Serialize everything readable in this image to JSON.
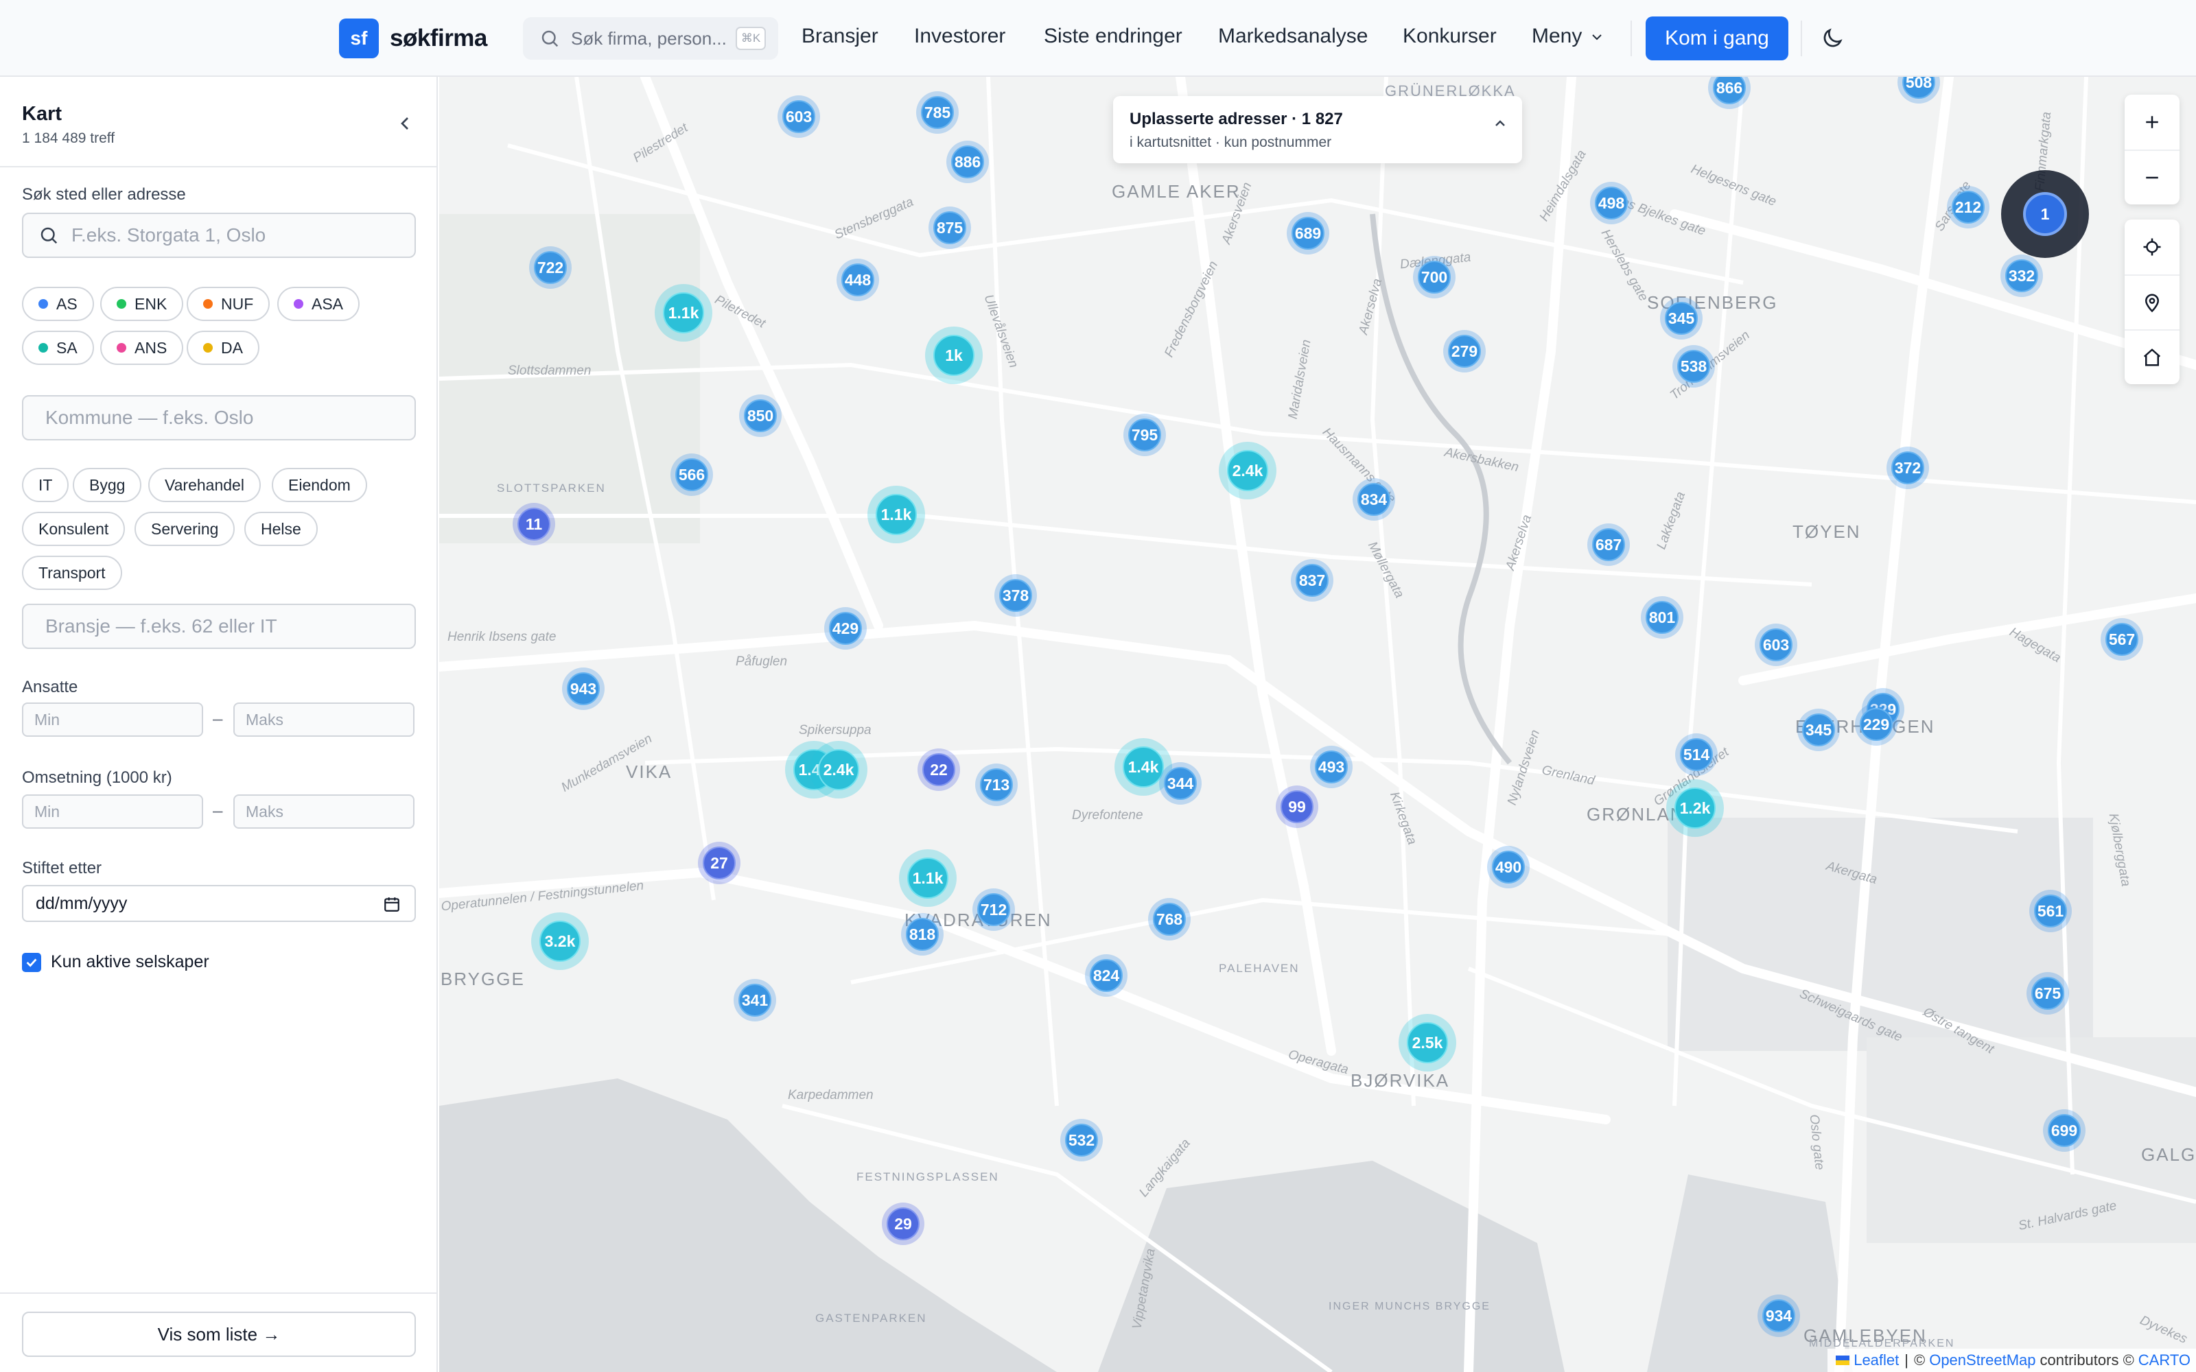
{
  "header": {
    "brand_logo": "sf",
    "brand_name": "søkfirma",
    "search_placeholder": "Søk firma, person...",
    "search_shortcut": "⌘K",
    "nav": [
      "Bransjer",
      "Investorer",
      "Siste endringer",
      "Markedsanalyse",
      "Konkurser"
    ],
    "menu_label": "Meny",
    "cta_label": "Kom i gang"
  },
  "sidebar": {
    "title": "Kart",
    "count": "1 184 489 treff",
    "place_label": "Søk sted eller adresse",
    "place_placeholder": "F.eks. Storgata 1, Oslo",
    "org_types": [
      {
        "label": "AS",
        "color": "#3b82f6"
      },
      {
        "label": "ENK",
        "color": "#22c55e"
      },
      {
        "label": "NUF",
        "color": "#f97316"
      },
      {
        "label": "ASA",
        "color": "#a855f7"
      },
      {
        "label": "SA",
        "color": "#14b8a6"
      },
      {
        "label": "ANS",
        "color": "#ec4899"
      },
      {
        "label": "DA",
        "color": "#eab308"
      }
    ],
    "kommune_placeholder": "Kommune — f.eks. Oslo",
    "industries": [
      "IT",
      "Bygg",
      "Varehandel",
      "Eiendom",
      "Konsulent",
      "Servering",
      "Helse",
      "Transport"
    ],
    "bransje_placeholder": "Bransje — f.eks. 62 eller IT",
    "employees_label": "Ansatte",
    "revenue_label": "Omsetning (1000 kr)",
    "min_placeholder": "Min",
    "max_placeholder": "Maks",
    "range_dash": "–",
    "founded_label": "Stiftet etter",
    "date_placeholder": "dd/mm/yyyy",
    "active_label": "Kun aktive selskaper",
    "active_checked": true,
    "list_button": "Vis som liste →"
  },
  "map": {
    "unplaced_title": "Uplasserte adresser · 1 827",
    "unplaced_sub": "i kartutsnittet · kun postnummer",
    "places": [
      "GRÜNERLØKKA",
      "GAMLE AKER",
      "SOFIENBERG",
      "TØYEN",
      "SLOTTSPARKEN",
      "VIKA",
      "ENERHAUGEN",
      "GRØNLAND",
      "KVADRATUREN",
      "BRYGGE",
      "BJØRVIKA",
      "GALGEBE",
      "GAMLEBYEN",
      "FESTNINGSPLASSEN",
      "GASTENPARKEN",
      "PALEHAVEN",
      "INGER MUNCHS BRYGGE",
      "MIDDELALDERPARKEN"
    ],
    "streets": [
      "Henrik Ibsens gate",
      "Påfuglen",
      "Spikersuppa",
      "Dyrefontene",
      "Slottsdammen",
      "Karpedammen",
      "Operagata",
      "Operatunnelen / Festningstunnelen",
      "Munkedamsveien",
      "Ullevålsveien",
      "Maridalsveien",
      "Akerselva",
      "Lakkegata",
      "Hagegata",
      "Schweigaards gate",
      "Østre tangent",
      "Kjølberggata",
      "Langkaigata",
      "Vippetangvika",
      "Nylandsveien",
      "Grenland",
      "Akergata",
      "Helgesens gate",
      "Sars gate",
      "Finnmarkgata",
      "St. Halvards gate",
      "Oslo gate",
      "Dyvekes",
      "Piletredet",
      "Stensberggata",
      "Fredensborgveien",
      "Hausmanns gate",
      "Trondheimsveien",
      "Akersbakken",
      "Dælenggata",
      "Akerselva",
      "Heimdalsgata",
      "Jens Bjelkes gate",
      "Pilestredet",
      "Herslebs gate",
      "Møllergata",
      "Grønlandsleiret",
      "Akersveien",
      "Kirkegata"
    ],
    "clusters": [
      {
        "label": "603",
        "kind": "blue"
      },
      {
        "label": "785",
        "kind": "blue"
      },
      {
        "label": "886",
        "kind": "blue"
      },
      {
        "label": "875",
        "kind": "blue"
      },
      {
        "label": "448",
        "kind": "blue"
      },
      {
        "label": "722",
        "kind": "blue"
      },
      {
        "label": "1.1k",
        "kind": "cyan"
      },
      {
        "label": "1k",
        "kind": "cyan"
      },
      {
        "label": "850",
        "kind": "blue"
      },
      {
        "label": "566",
        "kind": "blue"
      },
      {
        "label": "11",
        "kind": "indigo"
      },
      {
        "label": "1.1k",
        "kind": "cyan"
      },
      {
        "label": "378",
        "kind": "blue"
      },
      {
        "label": "429",
        "kind": "blue"
      },
      {
        "label": "943",
        "kind": "blue"
      },
      {
        "label": "1.4k",
        "kind": "cyan"
      },
      {
        "label": "2.4k",
        "kind": "cyan"
      },
      {
        "label": "22",
        "kind": "indigo"
      },
      {
        "label": "713",
        "kind": "blue"
      },
      {
        "label": "27",
        "kind": "indigo"
      },
      {
        "label": "1.1k",
        "kind": "cyan"
      },
      {
        "label": "712",
        "kind": "blue"
      },
      {
        "label": "818",
        "kind": "blue"
      },
      {
        "label": "3.2k",
        "kind": "cyan"
      },
      {
        "label": "341",
        "kind": "blue"
      },
      {
        "label": "768",
        "kind": "blue"
      },
      {
        "label": "824",
        "kind": "blue"
      },
      {
        "label": "532",
        "kind": "blue"
      },
      {
        "label": "29",
        "kind": "indigo"
      },
      {
        "label": "795",
        "kind": "blue"
      },
      {
        "label": "2.4k",
        "kind": "cyan"
      },
      {
        "label": "689",
        "kind": "blue"
      },
      {
        "label": "700",
        "kind": "blue"
      },
      {
        "label": "279",
        "kind": "blue"
      },
      {
        "label": "834",
        "kind": "blue"
      },
      {
        "label": "837",
        "kind": "blue"
      },
      {
        "label": "1.4k",
        "kind": "cyan"
      },
      {
        "label": "344",
        "kind": "blue"
      },
      {
        "label": "99",
        "kind": "indigo"
      },
      {
        "label": "493",
        "kind": "blue"
      },
      {
        "label": "498",
        "kind": "blue"
      },
      {
        "label": "345",
        "kind": "blue"
      },
      {
        "label": "538",
        "kind": "blue"
      },
      {
        "label": "687",
        "kind": "blue"
      },
      {
        "label": "801",
        "kind": "blue"
      },
      {
        "label": "603",
        "kind": "blue"
      },
      {
        "label": "490",
        "kind": "blue"
      },
      {
        "label": "514",
        "kind": "blue"
      },
      {
        "label": "1.2k",
        "kind": "cyan"
      },
      {
        "label": "2.5k",
        "kind": "cyan"
      },
      {
        "label": "345",
        "kind": "blue"
      },
      {
        "label": "329",
        "kind": "blue"
      },
      {
        "label": "229",
        "kind": "blue"
      },
      {
        "label": "866",
        "kind": "blue"
      },
      {
        "label": "508",
        "kind": "blue"
      },
      {
        "label": "212",
        "kind": "blue"
      },
      {
        "label": "1",
        "kind": "dark"
      },
      {
        "label": "332",
        "kind": "blue"
      },
      {
        "label": "372",
        "kind": "blue"
      },
      {
        "label": "567",
        "kind": "blue"
      },
      {
        "label": "561",
        "kind": "blue"
      },
      {
        "label": "675",
        "kind": "blue"
      },
      {
        "label": "699",
        "kind": "blue"
      },
      {
        "label": "934",
        "kind": "blue"
      }
    ],
    "attribution": {
      "leaflet": "Leaflet",
      "sep1": "|",
      "osm_prefix": "©",
      "osm": "OpenStreetMap",
      "contributors": "contributors ©",
      "carto": "CARTO"
    }
  }
}
